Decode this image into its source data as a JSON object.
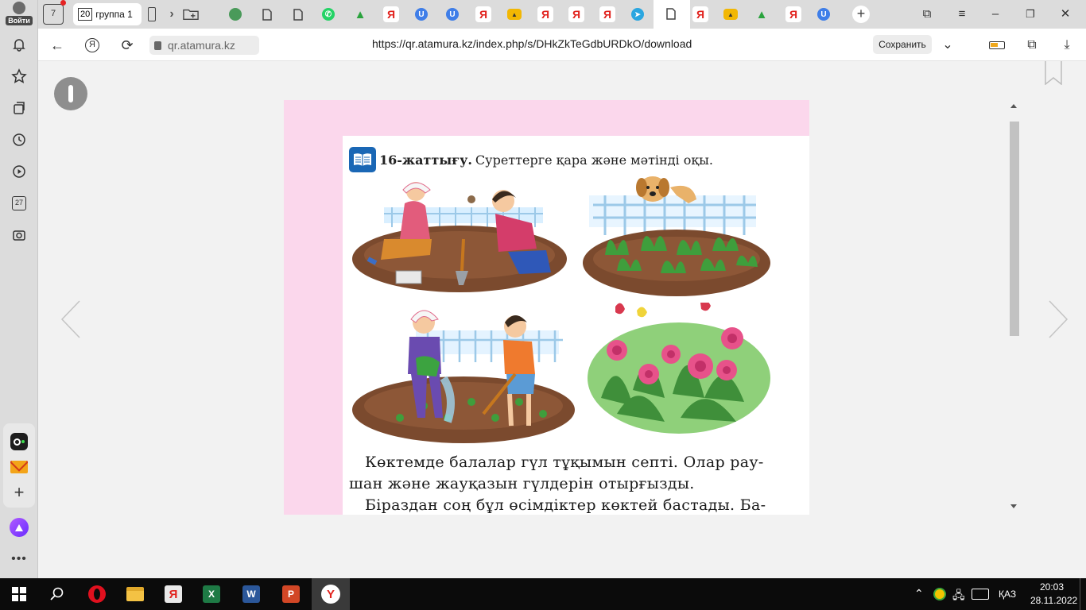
{
  "sidebar": {
    "login_label": "Войти",
    "icons": [
      "bell-icon",
      "star-icon",
      "collections-icon",
      "history-icon",
      "play-icon",
      "calendar-icon",
      "screenshot-icon"
    ],
    "calendar_day": "27",
    "bottom_icons": [
      "alice-camera-icon",
      "mail-icon",
      "add-icon",
      "alice-icon",
      "more-icon"
    ]
  },
  "tabbar": {
    "home_count": "7",
    "group_count": "20",
    "group_name": "группа 1"
  },
  "addressbar": {
    "domain": "qr.atamura.kz",
    "url": "https://qr.atamura.kz/index.php/s/DHkZkTeGdbURDkO/download",
    "save_label": "Сохранить"
  },
  "document": {
    "exercise_number": "16-жаттығу.",
    "exercise_instruction": "Суреттерге қара және мәтінді оқы.",
    "body_lines": [
      "Көктемде балалар гүл тұқымын септі. Олар рау-",
      "шан және жауқазын гүлдерін отырғызды.",
      "Біраздан соң бұл өсімдіктер көктей бастады. Ба-"
    ]
  },
  "taskbar": {
    "apps": [
      "start",
      "search",
      "opera",
      "file-explorer",
      "yandex",
      "excel",
      "word",
      "powerpoint",
      "yandex-browser"
    ],
    "language": "ҚАЗ",
    "time": "20:03",
    "date": "28.11.2022"
  },
  "colors": {
    "page_pink": "#fbd7ec",
    "exercise_icon_blue": "#1a67b5",
    "yandex_red": "#e1211c"
  }
}
